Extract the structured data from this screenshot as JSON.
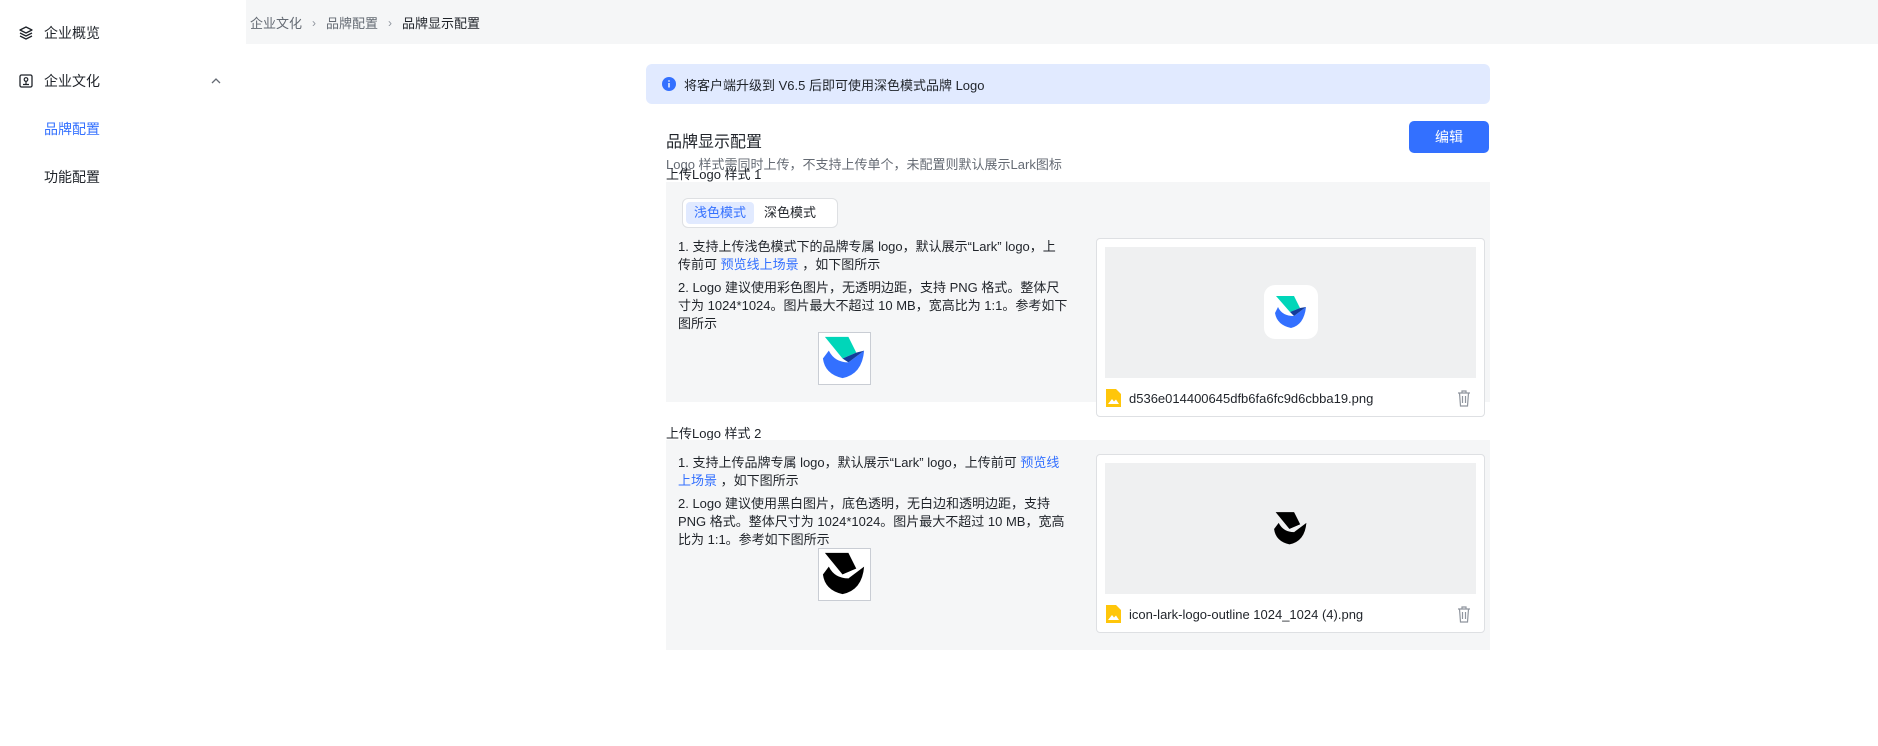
{
  "sidebar": {
    "items": [
      {
        "label": "企业概览",
        "icon": "layers-icon"
      },
      {
        "label": "企业文化",
        "icon": "culture-icon",
        "expanded": true
      },
      {
        "label": "品牌配置",
        "active": true
      },
      {
        "label": "功能配置"
      }
    ]
  },
  "breadcrumb": {
    "items": [
      "企业文化",
      "品牌配置",
      "品牌显示配置"
    ]
  },
  "banner": {
    "text": "将客户端升级到 V6.5 后即可使用深色模式品牌 Logo"
  },
  "section": {
    "title": "品牌显示配置",
    "desc": "Logo 样式需同时上传，不支持上传单个，未配置则默认展示Lark图标",
    "edit_label": "编辑"
  },
  "logo1": {
    "title": "上传Logo 样式 1",
    "tabs": [
      "浅色模式",
      "深色模式"
    ],
    "selected_tab": "浅色模式",
    "desc1_pre": "1. 支持上传浅色模式下的品牌专属 logo，默认展示“Lark” logo，上传前可 ",
    "desc1_link": "预览线上场景",
    "desc1_post": " ，如下图所示",
    "desc2": "2. Logo 建议使用彩色图片，无透明边距，支持 PNG 格式。整体尺寸为 1024*1024。图片最大不超过 10 MB，宽高比为 1:1。参考如下图所示",
    "file_name": "d536e014400645dfb6fa6fc9d6cbba19.png"
  },
  "logo2": {
    "title": "上传Logo 样式 2",
    "desc1_pre": "1. 支持上传品牌专属 logo，默认展示“Lark” logo，上传前可 ",
    "desc1_link": "预览线上场景",
    "desc1_post": " ，如下图所示",
    "desc2": "2. Logo 建议使用黑白图片，底色透明，无白边和透明边距，支持 PNG 格式。整体尺寸为 1024*1024。图片最大不超过 10 MB，宽高比为 1:1。参考如下图所示",
    "file_name": "icon-lark-logo-outline 1024_1024 (4).png"
  },
  "colors": {
    "accent": "#3370ff",
    "banner_bg": "#e1eaff",
    "lark_teal": "#00d6b9",
    "lark_blue": "#3370ff",
    "file_icon": "#ffc60a"
  }
}
